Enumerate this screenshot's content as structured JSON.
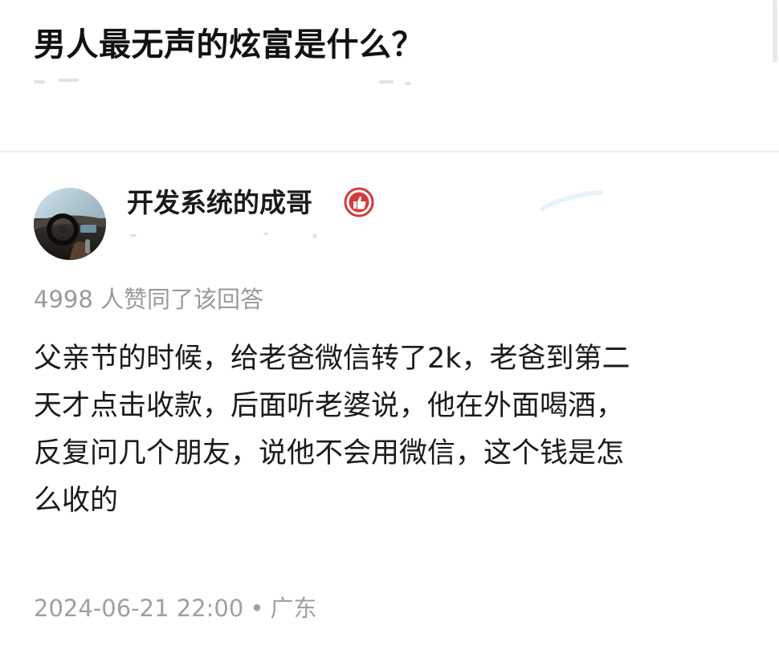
{
  "question": {
    "title": "男人最无声的炫富是什么？"
  },
  "answer": {
    "author_name": "开发系统的成哥",
    "likes_text": "4998 人赞同了该回答",
    "content_lines": [
      "父亲节的时候，给老爸微信转了2k，老爸到第二",
      "天才点击收款，后面听老婆说，他在外面喝酒，",
      "反复问几个朋友，说他不会用微信，这个钱是怎",
      "么收的"
    ],
    "timestamp": "2024-06-21 22:00",
    "separator": "•",
    "location": "广东"
  },
  "icons": {
    "avatar": "car-interior-avatar",
    "badge": "thumbs-up-badge-icon"
  },
  "colors": {
    "badge_red": "#d23b3b",
    "meta_gray": "#a0a0a0",
    "divider": "#eeeeee"
  }
}
